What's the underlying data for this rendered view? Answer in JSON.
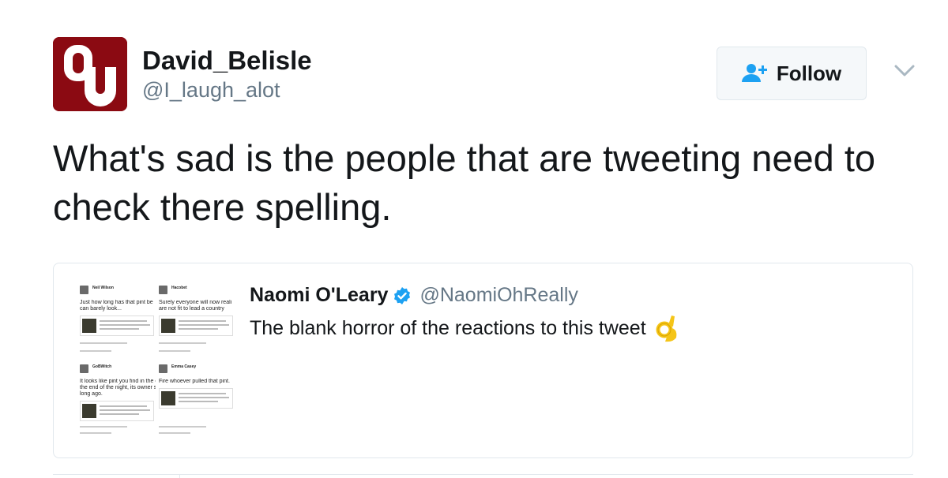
{
  "author": {
    "display_name": "David_Belisle",
    "handle": "@I_laugh_alot",
    "avatar_icon": "oklahoma-ou-logo",
    "avatar_color": "#8b0a12"
  },
  "follow_button": {
    "label": "Follow",
    "icon": "add-user-icon",
    "icon_color": "#1da1f2"
  },
  "menu": {
    "icon": "chevron-down-icon"
  },
  "tweet": {
    "text": "What's sad is the people that are tweeting need to check there spelling."
  },
  "quoted_tweet": {
    "display_name": "Naomi O'Leary",
    "verified": true,
    "verified_icon": "verified-badge-icon",
    "handle": "@NaomiOhReally",
    "text": "The blank horror of the reactions to this tweet",
    "emoji": "👌",
    "thumbnail": {
      "tweets": [
        {
          "name": "Neil Wilson",
          "text_lines": [
            "Just how long has that pint be",
            "can barely look..."
          ]
        },
        {
          "name": "Hacobet",
          "text_lines": [
            "Surely everyone will now reali",
            "are not fit to lead a country"
          ]
        },
        {
          "name": "GoBWitch",
          "text_lines": [
            "It looks like pint you find in the e",
            "the end of the night, its owner s",
            "long ago."
          ]
        },
        {
          "name": "Emma Casey",
          "text_lines": [
            "Fire whoever pulled that pint."
          ]
        }
      ]
    }
  }
}
